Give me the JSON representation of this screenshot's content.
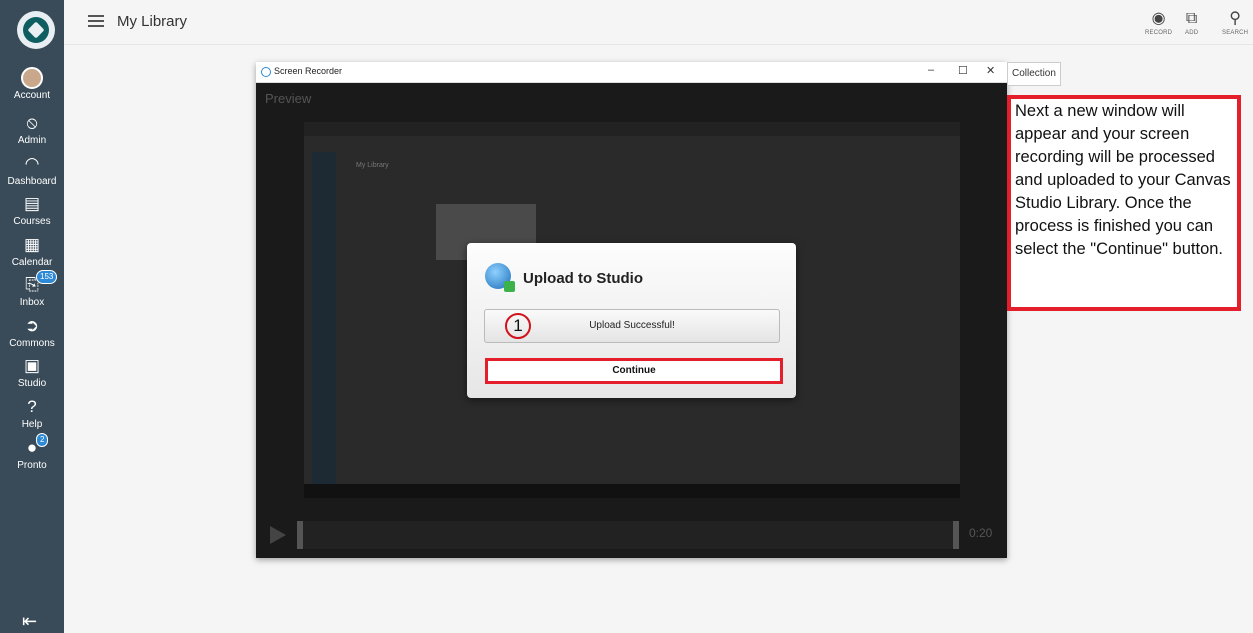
{
  "nav": {
    "items": [
      {
        "id": "account",
        "label": "Account"
      },
      {
        "id": "admin",
        "label": "Admin"
      },
      {
        "id": "dashboard",
        "label": "Dashboard"
      },
      {
        "id": "courses",
        "label": "Courses"
      },
      {
        "id": "calendar",
        "label": "Calendar"
      },
      {
        "id": "inbox",
        "label": "Inbox",
        "badge": "153"
      },
      {
        "id": "commons",
        "label": "Commons"
      },
      {
        "id": "studio",
        "label": "Studio"
      },
      {
        "id": "help",
        "label": "Help"
      },
      {
        "id": "pronto",
        "label": "Pronto",
        "badge": "2"
      }
    ]
  },
  "header": {
    "title": "My Library",
    "record_label": "RECORD",
    "add_label": "ADD",
    "search_label": "SEARCH"
  },
  "recorder": {
    "window_title": "Screen Recorder",
    "preview_label": "Preview",
    "time": "0:20",
    "inner_title": "My Library"
  },
  "dialog": {
    "title": "Upload to Studio",
    "status": "Upload Successful!",
    "step_number": "1",
    "continue_label": "Continue"
  },
  "collection_label": "Collection",
  "annotation": {
    "text": "Next a new window will appear and your screen recording will be processed and uploaded to your Canvas Studio Library. Once the process is finished you can select the \"Continue\" button."
  },
  "colors": {
    "nav_bg": "#394b58",
    "highlight": "#e41e2a",
    "badge": "#2d89d6"
  }
}
